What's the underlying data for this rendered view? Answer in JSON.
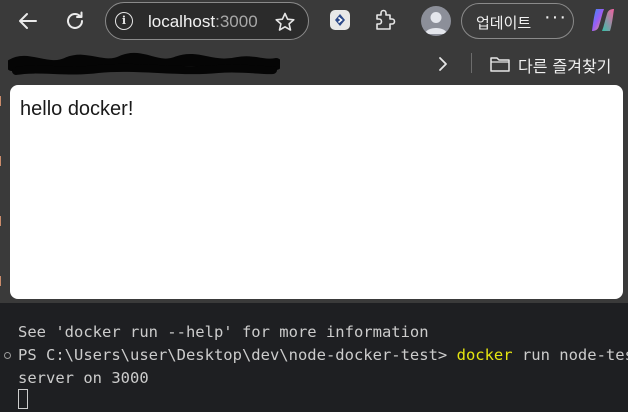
{
  "browser": {
    "address": {
      "host": "localhost",
      "port": ":3000"
    },
    "update_button": "업데이트",
    "more": "···",
    "bookmarks_folder": "다른 즐겨찾기"
  },
  "page": {
    "body_text": "hello docker!"
  },
  "terminal": {
    "line1": "See 'docker run --help' for more information",
    "line2_prompt": "PS C:\\Users\\user\\Desktop\\dev\\node-docker-test> ",
    "line2_cmd": "docker",
    "line2_args": " run node-test",
    "line3": "server on 3000"
  },
  "colors": {
    "terminal_keyword": "#e5e510",
    "terminal_bg": "#1e1f22",
    "browser_chrome": "#3a3a3a"
  },
  "icons": [
    "back-arrow-icon",
    "reload-icon",
    "info-icon",
    "star-icon",
    "extension-icon",
    "puzzle-icon",
    "profile-avatar-icon",
    "copilot-icon",
    "chevron-right-icon",
    "folder-icon"
  ]
}
